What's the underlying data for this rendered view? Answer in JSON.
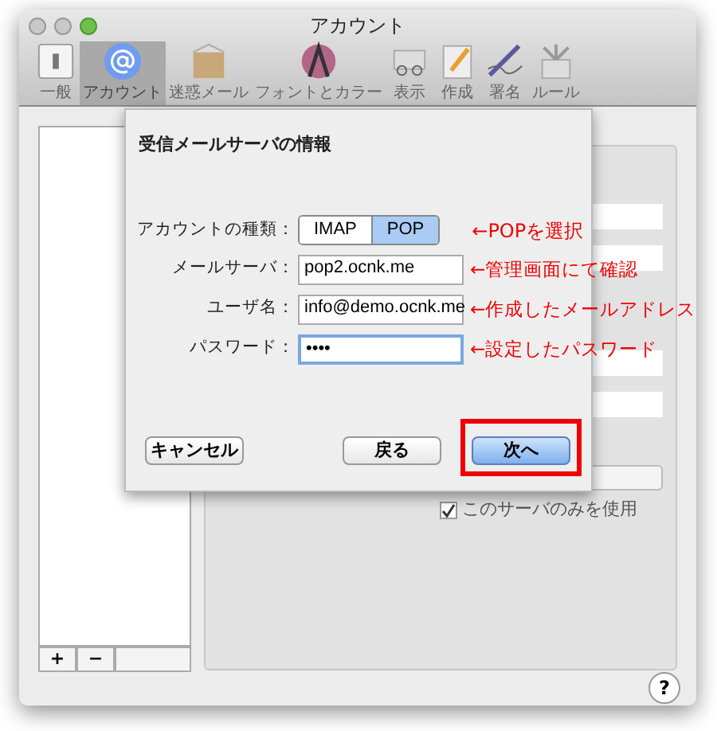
{
  "window": {
    "title": "アカウント"
  },
  "toolbar": [
    {
      "label": "一般",
      "kind": "general",
      "selected": false
    },
    {
      "label": "アカウント",
      "kind": "accounts",
      "selected": true
    },
    {
      "label": "迷惑メール",
      "kind": "junk",
      "selected": false
    },
    {
      "label": "フォントとカラー",
      "kind": "fonts",
      "selected": false
    },
    {
      "label": "表示",
      "kind": "viewing",
      "selected": false
    },
    {
      "label": "作成",
      "kind": "composing",
      "selected": false
    },
    {
      "label": "署名",
      "kind": "signatures",
      "selected": false
    },
    {
      "label": "ルール",
      "kind": "rules",
      "selected": false
    }
  ],
  "account_list": {
    "buttons": [
      "+",
      "−"
    ]
  },
  "sheet": {
    "title": "受信メールサーバの情報",
    "account_type": {
      "label": "アカウントの種類：",
      "options": [
        {
          "label": "IMAP",
          "selected": false
        },
        {
          "label": "POP",
          "selected": true
        }
      ],
      "annotation": "←POPを選択"
    },
    "fields": [
      {
        "label": "メールサーバ：",
        "value": "pop2.ocnk.me",
        "focused": false,
        "annotation": "←管理画面にて確認"
      },
      {
        "label": "ユーザ名：",
        "value": "info@demo.ocnk.me",
        "focused": false,
        "annotation": "←作成したメールアドレス"
      },
      {
        "label": "パスワード：",
        "value": "••••",
        "focused": true,
        "annotation": "←設定したパスワード"
      }
    ],
    "buttons": [
      {
        "label": "キャンセル",
        "default": false,
        "highlighted": false
      },
      {
        "label": "戻る",
        "default": false,
        "highlighted": false
      },
      {
        "label": "次へ",
        "default": true,
        "highlighted": true
      }
    ]
  },
  "background_panel": {
    "checkbox": {
      "label": "このサーバのみを使用",
      "checked": true
    }
  },
  "help_button": "?"
}
